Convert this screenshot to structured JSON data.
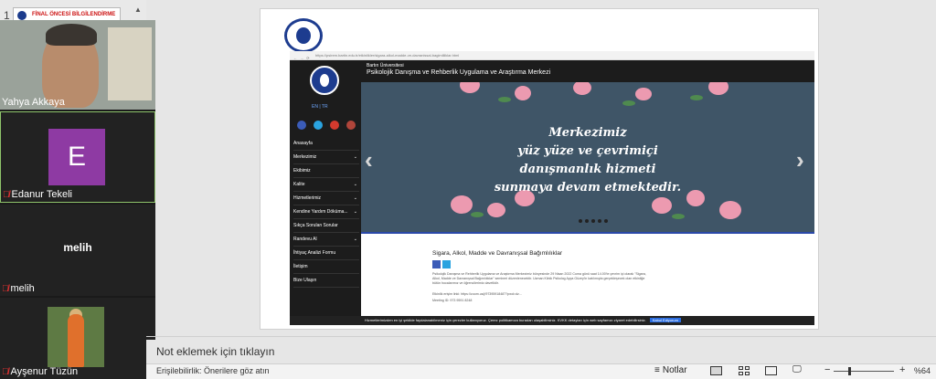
{
  "thumbnail": {
    "number": "1",
    "title": "FİNAL ÖNCESİ BİLGİLENDİRME"
  },
  "participants": [
    {
      "name": "Yahya Akkaya",
      "muted": false
    },
    {
      "name": "Edanur Tekeli",
      "muted": true,
      "avatar_letter": "E"
    },
    {
      "name": "melih",
      "muted": true,
      "center_label": "melih"
    },
    {
      "name": "Ayşenur Tüzün",
      "muted": true
    }
  ],
  "website": {
    "url": "https://psirem.bartin.edu.tr/etkinlikler/sigara-alkol-madde-ve-davranissal-bagimliliklar.html",
    "university": "Bartın Üniversitesi",
    "center_name": "Psikolojik Danışma ve Rehberlik Uygulama ve Araştırma Merkezi",
    "lang": "EN | TR",
    "nav": [
      {
        "label": "Anasayfa",
        "has_sub": false
      },
      {
        "label": "Merkezimiz",
        "has_sub": true
      },
      {
        "label": "Ekibimiz",
        "has_sub": false
      },
      {
        "label": "Kalite",
        "has_sub": true
      },
      {
        "label": "Hizmetlerimiz",
        "has_sub": true
      },
      {
        "label": "Kendine Yardım Döküma...",
        "has_sub": true
      },
      {
        "label": "Sıkça Sorulan Sorular",
        "has_sub": false
      },
      {
        "label": "Randevu Al",
        "has_sub": true
      },
      {
        "label": "İhtiyaç Analizi Formu",
        "has_sub": false
      },
      {
        "label": "İletişim",
        "has_sub": false
      },
      {
        "label": "Bize Ulaşın",
        "has_sub": false
      }
    ],
    "banner_lines": [
      "Merkezimiz",
      "yüz yüze ve çevrimiçi",
      "danışmanlık hizmeti",
      "sunmaya devam etmektedir."
    ],
    "article_title": "Sigara, Alkol, Madde ve Davranışsal Bağımlılıklar",
    "para1": "Psikolojik Danışma ve Rehberlik Uygulama ve Araştırma Merkezimiz bünyesinde 29 Nisan 2022 Cuma günü saat 14.00'te çevrim içi olarak \"Sigara, Alkol, Madde ve Davranışsal Bağımlılıklar\" semineri düzenlenecektir. Uzman Klinik Psikolog Ayça Güzey'in katılımıyla gerçekleşecek olan etkinliğe bütün hocalarımız ve öğrencilerimiz davetlidir.",
    "para2": "Etkinlik erişim linki: https://zoom.us/j/97395918487?pwd=dz...",
    "para3": "Meeting ID: 973 9591 8248",
    "cookie_text": "Hizmetlerimizden en iyi şekilde faydalanabilmeniz için çerezler kullanıyoruz. Çerez politikamıza buradan ulaşabilirsiniz. KVKK detayları için web sayfamızı ziyaret edebilirsiniz.",
    "cookie_button": "Kabul Ediyorum"
  },
  "notes_placeholder": "Not eklemek için tıklayın",
  "status": {
    "accessibility": "Erişilebilirlik: Önerilere göz atın",
    "notes": "Notlar",
    "zoom": "%64"
  }
}
